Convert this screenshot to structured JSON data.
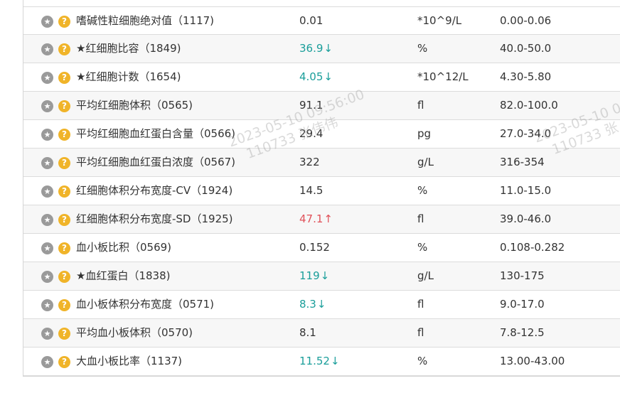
{
  "icons": {
    "star": "star-icon",
    "help": "question-icon",
    "down_arrow": "↓",
    "up_arrow": "↑"
  },
  "colors": {
    "low": "#1a9e9a",
    "high": "#e0525a",
    "star_button": "#9a9a9a",
    "help_button": "#f0b429"
  },
  "rows": [
    {
      "name": "嗜碱性粒细胞绝对值（1117)",
      "result": "0.01",
      "flag": "",
      "unit": "*10^9/L",
      "range": "0.00-0.06"
    },
    {
      "name": "★红细胞比容（1849)",
      "result": "36.9",
      "flag": "↓",
      "unit": "%",
      "range": "40.0-50.0"
    },
    {
      "name": "★红细胞计数（1654)",
      "result": "4.05",
      "flag": "↓",
      "unit": "*10^12/L",
      "range": "4.30-5.80"
    },
    {
      "name": "平均红细胞体积（0565)",
      "result": "91.1",
      "flag": "",
      "unit": "fl",
      "range": "82.0-100.0"
    },
    {
      "name": "平均红细胞血红蛋白含量（0566)",
      "result": "29.4",
      "flag": "",
      "unit": "pg",
      "range": "27.0-34.0"
    },
    {
      "name": "平均红细胞血红蛋白浓度（0567)",
      "result": "322",
      "flag": "",
      "unit": "g/L",
      "range": "316-354"
    },
    {
      "name": "红细胞体积分布宽度-CV（1924)",
      "result": "14.5",
      "flag": "",
      "unit": "%",
      "range": "11.0-15.0"
    },
    {
      "name": "红细胞体积分布宽度-SD（1925)",
      "result": "47.1",
      "flag": "↑",
      "unit": "fl",
      "range": "39.0-46.0"
    },
    {
      "name": "血小板比积（0569)",
      "result": "0.152",
      "flag": "",
      "unit": "%",
      "range": "0.108-0.282"
    },
    {
      "name": "★血红蛋白（1838)",
      "result": "119",
      "flag": "↓",
      "unit": "g/L",
      "range": "130-175"
    },
    {
      "name": "血小板体积分布宽度（0571)",
      "result": "8.3",
      "flag": "↓",
      "unit": "fl",
      "range": "9.0-17.0"
    },
    {
      "name": "平均血小板体积（0570)",
      "result": "8.1",
      "flag": "",
      "unit": "fl",
      "range": "7.8-12.5"
    },
    {
      "name": "大血小板比率（1137)",
      "result": "11.52",
      "flag": "↓",
      "unit": "%",
      "range": "13.00-43.00"
    }
  ],
  "watermarks": [
    {
      "line1": "2023-05-10 09:56:00",
      "line2": "110733 张伟伟"
    },
    {
      "line1": "2023-05-10 09",
      "line2": "110733 张"
    }
  ]
}
